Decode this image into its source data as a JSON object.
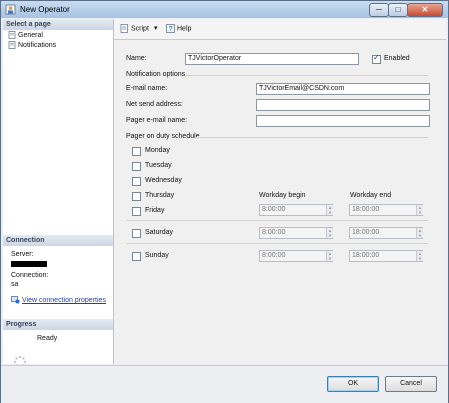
{
  "window": {
    "title": "New Operator",
    "min_glyph": "─",
    "max_glyph": "□",
    "close_glyph": "✕"
  },
  "left": {
    "select_page_heading": "Select a page",
    "pages": [
      {
        "label": "General",
        "icon": "page-icon"
      },
      {
        "label": "Notifications",
        "icon": "page-icon"
      }
    ],
    "connection_heading": "Connection",
    "server_label": "Server:",
    "connection_label": "Connection:",
    "connection_value": "sa",
    "view_connection_link": "View connection properties",
    "progress_heading": "Progress",
    "progress_status": "Ready"
  },
  "toolbar": {
    "script_label": "Script",
    "help_label": "Help"
  },
  "form": {
    "name_label": "Name:",
    "name_value": "TJVictorOperator",
    "enabled_label": "Enabled",
    "enabled_checked": true,
    "notification_heading": "Notification options",
    "email_label": "E-mail name:",
    "email_value": "TJVictorEmail@CSDN.com",
    "netsend_label": "Net send address:",
    "netsend_value": "",
    "pager_label": "Pager e-mail name:",
    "pager_value": "",
    "schedule_heading": "Pager on duty schedule",
    "days": [
      "Monday",
      "Tuesday",
      "Wednesday",
      "Thursday",
      "Friday",
      "Saturday",
      "Sunday"
    ],
    "workday_begin_label": "Workday begin",
    "workday_end_label": "Workday end",
    "weekday_begin": "8:00:00",
    "weekday_end": "18:00:00",
    "saturday_begin": "8:00:00",
    "saturday_end": "18:00:00",
    "sunday_begin": "8:00:00",
    "sunday_end": "18:00:00"
  },
  "buttons": {
    "ok": "OK",
    "cancel": "Cancel"
  },
  "colors": {
    "link": "#1a3fb5",
    "titlebar": "#a7c2e3",
    "close": "#c54d32"
  }
}
